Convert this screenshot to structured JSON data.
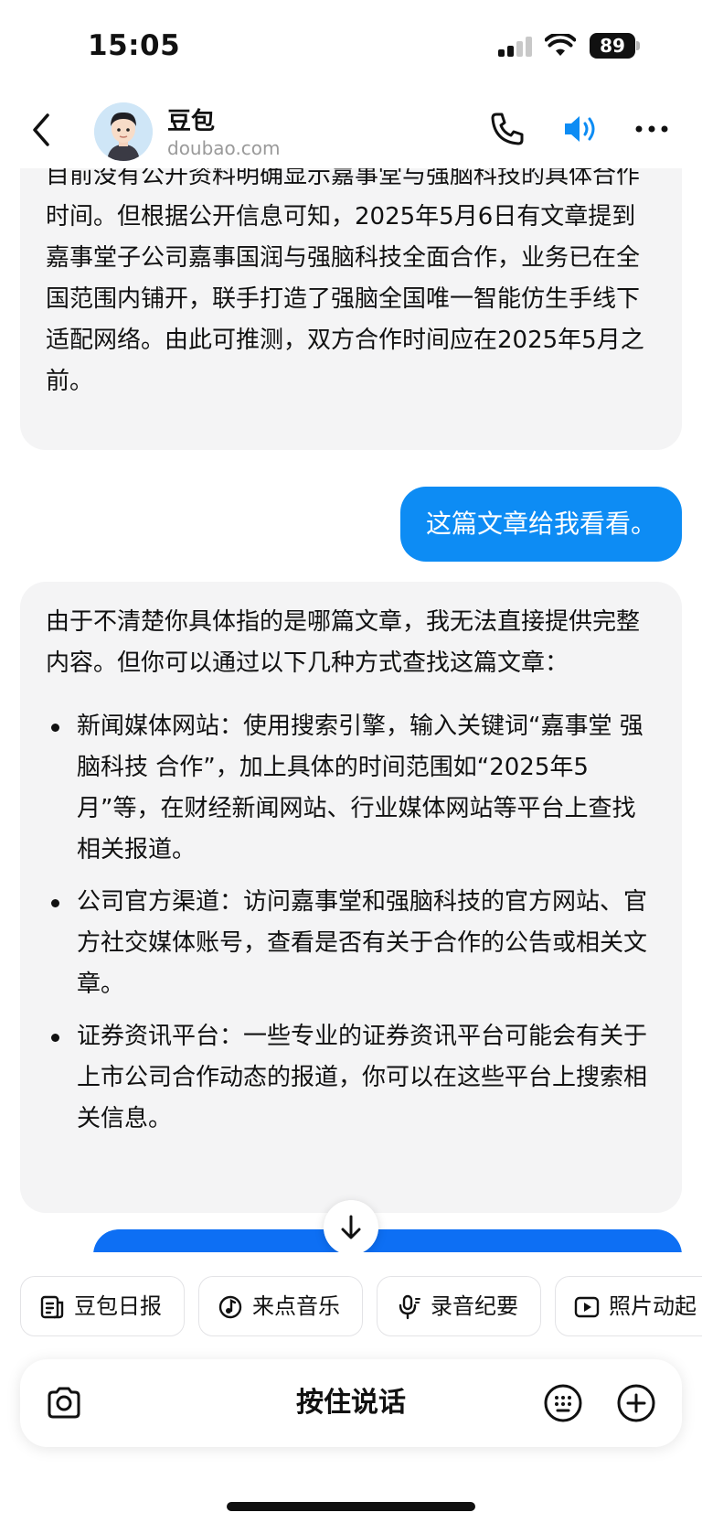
{
  "status_bar": {
    "time": "15:05",
    "battery": "89"
  },
  "header": {
    "title": "豆包",
    "subtitle": "doubao.com"
  },
  "messages": {
    "bot1": "目前没有公开资料明确显示嘉事堂与强脑科技的具体合作时间。但根据公开信息可知，2025年5月6日有文章提到嘉事堂子公司嘉事国润与强脑科技全面合作，业务已在全国范围内铺开，联手打造了强脑全国唯一智能仿生手线下适配网络。由此可推测，双方合作时间应在2025年5月之前。",
    "user1": "这篇文章给我看看。",
    "bot2_intro": "由于不清楚你具体指的是哪篇文章，我无法直接提供完整内容。但你可以通过以下几种方式查找这篇文章：",
    "bot2_items": [
      "新闻媒体网站：使用搜索引擎，输入关键词“嘉事堂 强脑科技 合作”，加上具体的时间范围如“2025年5月”等，在财经新闻网站、行业媒体网站等平台上查找相关报道。",
      "公司官方渠道：访问嘉事堂和强脑科技的官方网站、官方社交媒体账号，查看是否有关于合作的公告或相关文章。",
      "证券资讯平台：一些专业的证券资讯平台可能会有关于上市公司合作动态的报道，你可以在这些平台上搜索相关信息。"
    ]
  },
  "quick_actions": [
    {
      "label": "豆包日报",
      "icon": "news-icon"
    },
    {
      "label": "来点音乐",
      "icon": "music-icon"
    },
    {
      "label": "录音纪要",
      "icon": "microphone-icon"
    },
    {
      "label": "照片动起",
      "icon": "play-video-icon"
    }
  ],
  "input": {
    "hold_to_talk": "按住说话"
  },
  "colors": {
    "user_bubble": "#0d8cf4",
    "bot_bubble": "#f4f4f5",
    "accent": "#0d8cf4"
  }
}
